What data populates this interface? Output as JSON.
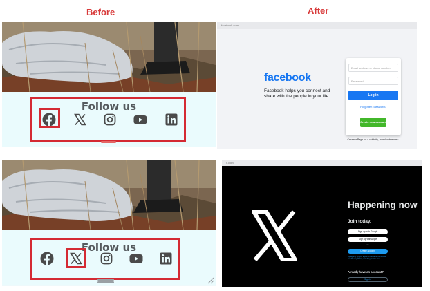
{
  "labels": {
    "before": "Before",
    "after": "After"
  },
  "follow_title": "Follow us",
  "social_icons": [
    "facebook-icon",
    "x-icon",
    "instagram-icon",
    "youtube-icon",
    "linkedin-icon"
  ],
  "colors": {
    "label_red": "#d83a3a",
    "highlight_red": "#d42a33",
    "follow_bar": "#eafbfd",
    "facebook_blue": "#1877f2",
    "facebook_green": "#42b72a",
    "x_blue": "#1d9bf0"
  },
  "facebook_page": {
    "url": "facebook.com",
    "logo": "facebook",
    "tagline": "Facebook helps you connect and share with the people in your life.",
    "email_placeholder": "Email address or phone number",
    "password_placeholder": "Password",
    "login_label": "Log in",
    "forgot_label": "Forgotten password?",
    "create_label": "Create new account",
    "page_note": "Create a Page for a celebrity, brand or business."
  },
  "x_page": {
    "url": "x.com",
    "headline": "Happening now",
    "join": "Join today.",
    "google_label": "Sign up with Google",
    "apple_label": "Sign up with Apple",
    "or_label": "or",
    "create_label": "Create account",
    "terms": "By signing up, you agree to the Terms of Service and Privacy Policy, including Cookie Use.",
    "already_label": "Already have an account?",
    "signin_label": "Sign in"
  }
}
